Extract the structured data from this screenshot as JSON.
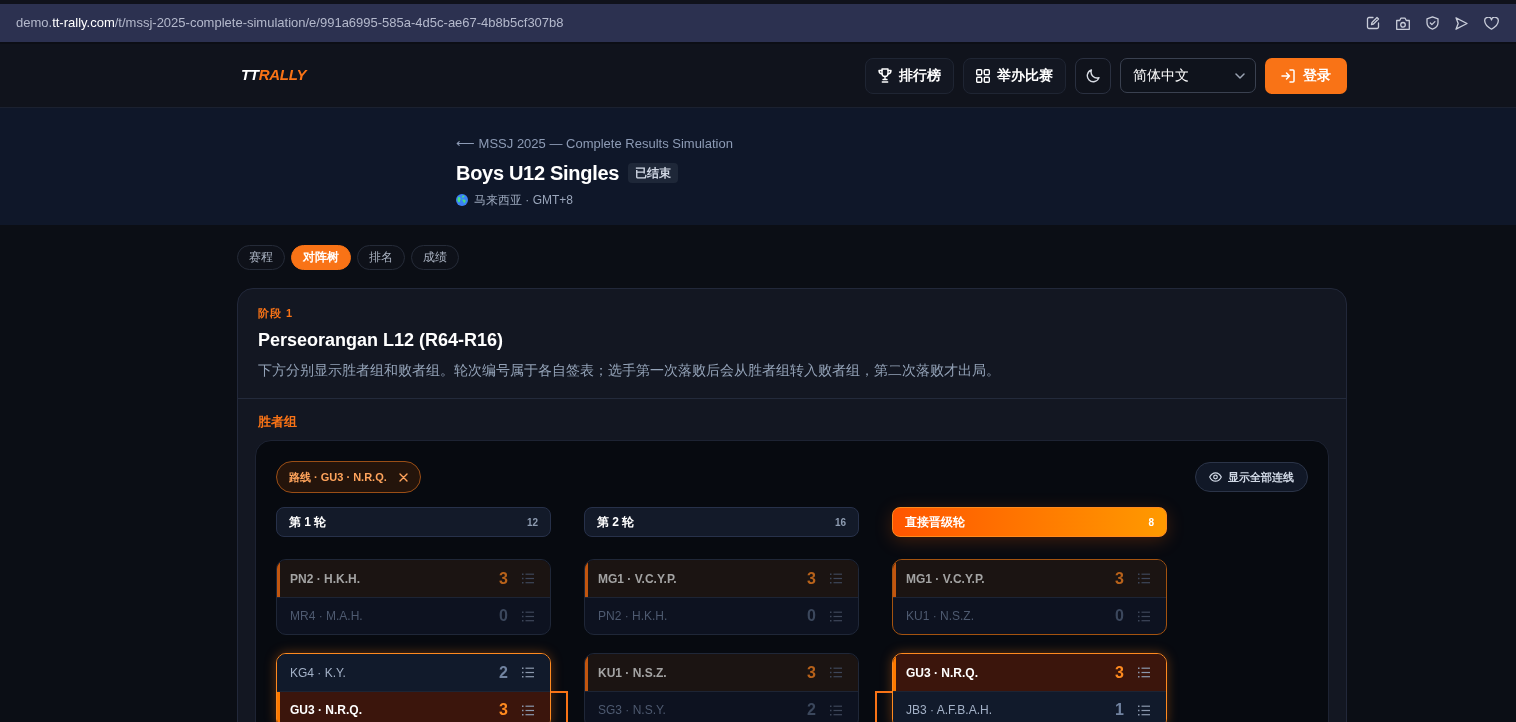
{
  "browser": {
    "url": "demo.**tt-rally.com**/t/mssj-2025-complete-simulation/e/991a6995-585a-4d5c-ae67-4b8b5cf307b8"
  },
  "header": {
    "logo": "**TT**RALLY",
    "leaderboard_button": "排行榜",
    "host_button": "举办比赛",
    "language_select": {
      "value": "简体中文"
    },
    "login_button": "登录"
  },
  "hero": {
    "back_link": "⟵ MSSJ 2025 — Complete Results Simulation",
    "title": "Boys U12 Singles",
    "status_badge": "已结束",
    "location": "马来西亚 · GMT+8"
  },
  "tabs": [
    {
      "label": "赛程",
      "selected": false
    },
    {
      "label": "对阵树",
      "selected": true
    },
    {
      "label": "排名",
      "selected": false
    },
    {
      "label": "成绩",
      "selected": false
    }
  ],
  "stage": {
    "label": "阶段 1",
    "title": "Perseorangan L12 (R64-R16)",
    "description": "下方分别显示胜者组和败者组。轮次编号属于各自签表；选手第一次落败后会从胜者组转入败者组，第二次落败才出局。"
  },
  "winners_bracket": {
    "label": "胜者组",
    "route_chip": {
      "label": "路线 · GU3 · N.R.Q."
    },
    "show_all_button": "显示全部连线",
    "rounds": [
      {
        "title": "第 1 轮",
        "count": "12",
        "kind": "regular",
        "matches": [
          {
            "highlighted": false,
            "route_out": false,
            "route_in": false,
            "players": [
              {
                "name": "PN2 · H.K.H.",
                "score": "3",
                "winner": true
              },
              {
                "name": "MR4 · M.A.H.",
                "score": "0",
                "winner": false
              }
            ]
          },
          {
            "highlighted": true,
            "route_out": true,
            "route_in": false,
            "players": [
              {
                "name": "KG4 · K.Y.",
                "score": "2",
                "winner": false
              },
              {
                "name": "GU3 · N.R.Q.",
                "score": "3",
                "winner": true
              }
            ]
          }
        ]
      },
      {
        "title": "第 2 轮",
        "count": "16",
        "kind": "regular",
        "matches": [
          {
            "highlighted": false,
            "route_out": false,
            "route_in": false,
            "players": [
              {
                "name": "MG1 · V.C.Y.P.",
                "score": "3",
                "winner": true
              },
              {
                "name": "PN2 · H.K.H.",
                "score": "0",
                "winner": false
              }
            ]
          },
          {
            "highlighted": false,
            "route_out": false,
            "route_in": false,
            "players": [
              {
                "name": "KU1 · N.S.Z.",
                "score": "3",
                "winner": true
              },
              {
                "name": "SG3 · N.S.Y.",
                "score": "2",
                "winner": false
              }
            ]
          }
        ]
      },
      {
        "title": "直接晋级轮",
        "count": "8",
        "kind": "advance",
        "matches": [
          {
            "highlighted": false,
            "route_out": false,
            "route_in": false,
            "players": [
              {
                "name": "MG1 · V.C.Y.P.",
                "score": "3",
                "winner": true
              },
              {
                "name": "KU1 · N.S.Z.",
                "score": "0",
                "winner": false
              }
            ]
          },
          {
            "highlighted": true,
            "route_out": false,
            "route_in": true,
            "players": [
              {
                "name": "GU3 · N.R.Q.",
                "score": "3",
                "winner": true
              },
              {
                "name": "JB3 · A.F.B.A.H.",
                "score": "1",
                "winner": false
              }
            ]
          }
        ]
      }
    ]
  }
}
